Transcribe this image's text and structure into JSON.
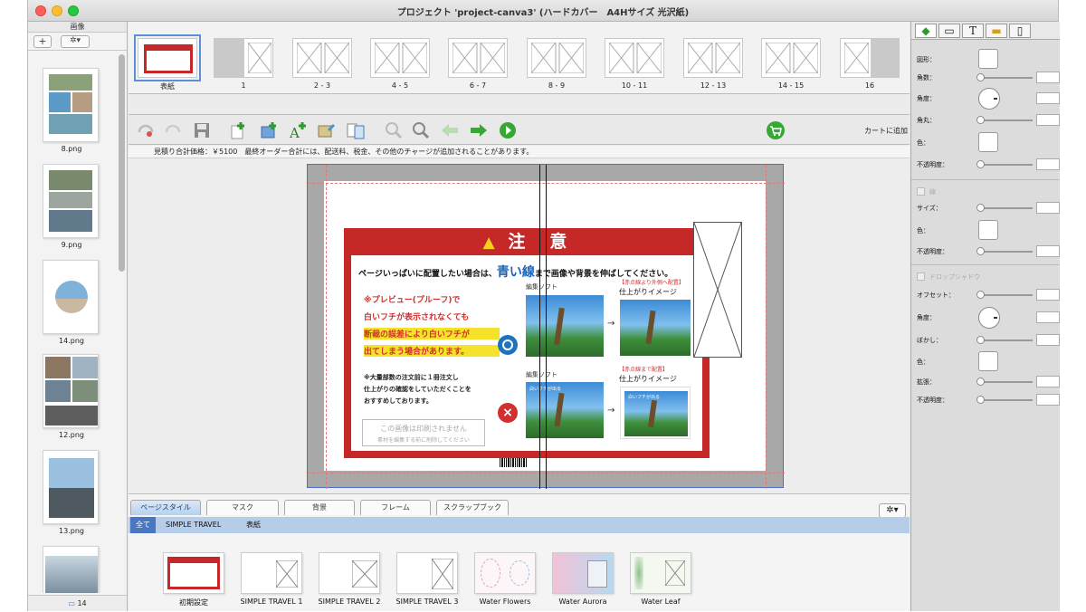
{
  "window": {
    "title": "プロジェクト 'project-canva3' (ハードカバー　A4Hサイズ 光沢紙)"
  },
  "image_panel": {
    "header": "画像",
    "add_label": "+",
    "gear_label": "✲▾",
    "items": [
      {
        "name": "8.png"
      },
      {
        "name": "9.png"
      },
      {
        "name": "14.png"
      },
      {
        "name": "12.png"
      },
      {
        "name": "13.png"
      }
    ],
    "footer_count": "14"
  },
  "spreads": [
    {
      "label": "表紙"
    },
    {
      "label": "1"
    },
    {
      "label": "2 - 3"
    },
    {
      "label": "4 - 5"
    },
    {
      "label": "6 - 7"
    },
    {
      "label": "8 - 9"
    },
    {
      "label": "10 - 11"
    },
    {
      "label": "12 - 13"
    },
    {
      "label": "14 - 15"
    },
    {
      "label": "16"
    }
  ],
  "toolbar": {
    "cart_label": "カートに追加"
  },
  "price_bar": {
    "text": "見積り合計価格：￥5100　最終オーダー合計には、配送料、税金、その他のチャージが追加されることがあります。"
  },
  "notice": {
    "title": "注　意",
    "line1_pre": "ページいっぱいに配置したい場合は、",
    "line1_blue": "青い線",
    "line1_post": "まで画像や背景を伸ばしてください。",
    "red_lines": [
      "※プレビュー(プルーフ)で",
      "白いフチが表示されなくても",
      "断裁の誤差により白いフチが",
      "出てしまう場合があります。"
    ],
    "small_lines": [
      "※大量部数の注文前に１冊注文し",
      "仕上がりの確認をしていただくことを",
      "おすすめしております。"
    ],
    "print_note": "この画像は印刷されません",
    "print_note_sub": "素材を編集する前に削除してください",
    "edit_soft": "編集ソフト",
    "finish_image": "仕上がりイメージ",
    "tag_ok": "【赤点線より外側へ配置】",
    "tag_ng": "【赤点線まで配置】",
    "ng_overlay": "白いフチが出る"
  },
  "bottom_tabs": [
    {
      "label": "ページスタイル"
    },
    {
      "label": "マスク"
    },
    {
      "label": "背景"
    },
    {
      "label": "フレーム"
    },
    {
      "label": "スクラップブック"
    }
  ],
  "bottom_subtabs": [
    {
      "label": "全て"
    },
    {
      "label": "SIMPLE TRAVEL"
    },
    {
      "label": "表紙"
    }
  ],
  "styles": [
    {
      "label": "初期設定"
    },
    {
      "label": "SIMPLE TRAVEL 1"
    },
    {
      "label": "SIMPLE TRAVEL 2"
    },
    {
      "label": "SIMPLE TRAVEL 3"
    },
    {
      "label": "Water Flowers"
    },
    {
      "label": "Water Aurora"
    },
    {
      "label": "Water Leaf"
    }
  ],
  "inspector": {
    "tabs": [
      "shape-tab",
      "frame-tab",
      "T",
      "ruler-tab",
      "page-tab"
    ],
    "shape_label": "図形：",
    "corners_label": "角数：",
    "angle_label": "角度：",
    "round_label": "角丸：",
    "color_label": "色：",
    "opacity_label": "不透明度：",
    "border_label": "線",
    "size_label": "サイズ：",
    "shadow_label": "ドロップシャドウ",
    "offset_label": "オフセット：",
    "blur_label": "ぼかし：",
    "spread_label": "拡張："
  },
  "colors": {
    "accent": "#4a78c0",
    "notice_red": "#c62828",
    "blue_line": "#1565c0"
  }
}
